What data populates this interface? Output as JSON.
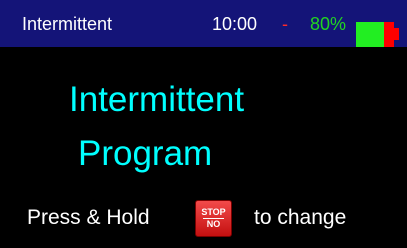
{
  "status": {
    "mode": "Intermittent",
    "time": "10:00",
    "separator": "-",
    "battery_text": "80%",
    "battery_level": 0.8
  },
  "main": {
    "title_line1": "Intermittent",
    "title_line2": "Program"
  },
  "prompt": {
    "before": "Press & Hold",
    "key_top": "STOP",
    "key_bottom": "NO",
    "after": "to change"
  },
  "colors": {
    "status_bg": "#141478",
    "title": "#00ffff",
    "battery_fill": "#22ee22",
    "battery_empty": "#ff0000",
    "stop_key": "#e02020"
  },
  "icons": {
    "battery": "battery-icon",
    "stop_key": "stop-no-key-icon"
  }
}
